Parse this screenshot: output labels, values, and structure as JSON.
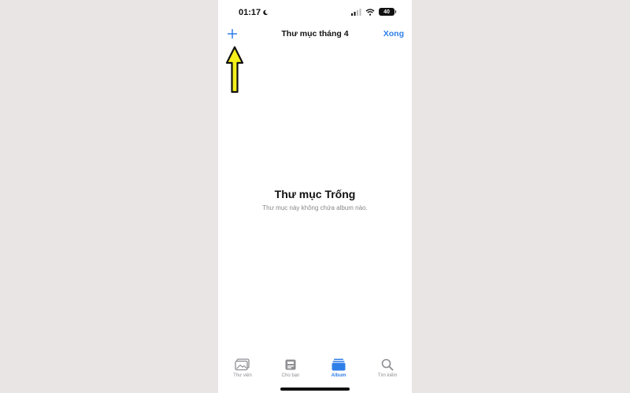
{
  "status_bar": {
    "time": "01:17",
    "battery": "40"
  },
  "nav": {
    "title": "Thư mục tháng 4",
    "done_label": "Xong"
  },
  "empty_state": {
    "title": "Thư mục Trống",
    "subtitle": "Thư mục này không chứa album nào."
  },
  "tabs": [
    {
      "label": "Thư viện",
      "icon": "photo-library-icon",
      "active": false
    },
    {
      "label": "Cho bạn",
      "icon": "for-you-icon",
      "active": false
    },
    {
      "label": "Album",
      "icon": "album-icon",
      "active": true
    },
    {
      "label": "Tìm kiếm",
      "icon": "search-icon",
      "active": false
    }
  ],
  "colors": {
    "accent": "#2f7fe8",
    "annotation_arrow": "#f5ef1a",
    "background": "#e8e5e4"
  }
}
